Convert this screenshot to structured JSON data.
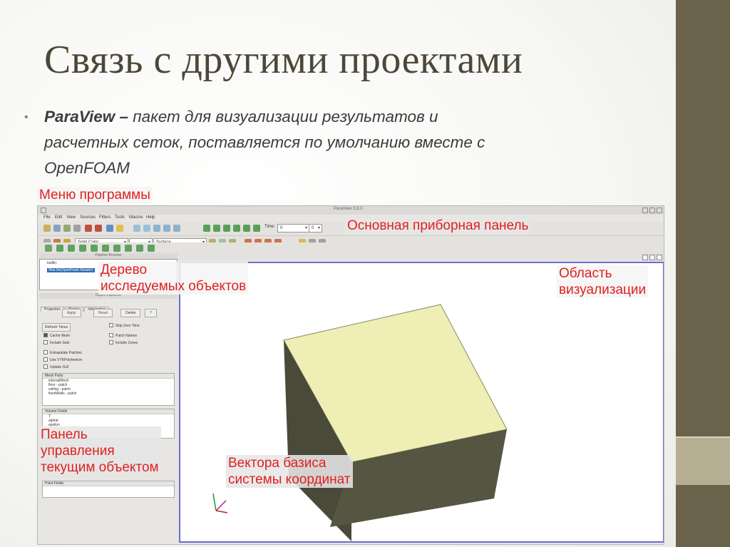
{
  "slide": {
    "title": "Связь с другими проектами",
    "bullet_term": "ParaView – ",
    "bullet_text_1": "пакет для визуализации результатов и",
    "bullet_text_2": "расчетных сеток, поставляется по умолчанию вместе с",
    "bullet_text_3": "OpenFOAM"
  },
  "colors": {
    "accent_stripe": "#6a624a",
    "stripe_light": "#b5ae92",
    "annotation": "#e02020",
    "cube_top": "#efeeb4",
    "cube_side": "#4a4a3a"
  },
  "annotations": {
    "menu": "Меню программы",
    "toolbar": "Основная приборная панель",
    "tree_1": "Дерево",
    "tree_2": "исследуемых объектов",
    "viz_1": "Область",
    "viz_2": "визуализации",
    "panel_1": "Панель",
    "panel_2": "управления",
    "panel_3": "текущим объектом",
    "basis_1": "Вектора базиса",
    "basis_2": "системы координат"
  },
  "app": {
    "window_title": "ParaView 3.8.0",
    "menu": [
      "File",
      "Edit",
      "View",
      "Sources",
      "Filters",
      "Tools",
      "Macros",
      "Help"
    ],
    "time_label": "Time:",
    "time_value": "0",
    "time_step": "0",
    "color_combo": "Solid Color",
    "repr_combo": "Surface",
    "pipeline_header": "Pipeline Browser",
    "pipeline_items": [
      "builtin:",
      "0fsd.0e(OpenFoam Reader)"
    ],
    "inspector_header": "Object Inspector",
    "tabs": [
      "Properties",
      "Display",
      "Information"
    ],
    "buttons": {
      "apply": "Apply",
      "reset": "Reset",
      "delete": "Delete",
      "help": "?"
    },
    "refresh_button": "Refresh Times",
    "props": {
      "skip_zero": "Skip Zero Time",
      "cache_mesh": "Cache Mesh",
      "patch_names": "Patch Names",
      "include_sets": "Include Sets",
      "include_zones": "Include Zones",
      "extrapolate": "Extrapolate Patches",
      "use_vtkpoly": "Use VTKPolyhedron",
      "update_gui": "Update GUI"
    },
    "mesh_parts": {
      "header": "Mesh Parts",
      "items": [
        "internalMesh",
        "floor - patch",
        "ceiling - patch",
        "fixedWalls - patch"
      ]
    },
    "volume_fields": {
      "header": "Volume Fields",
      "items": [
        "T",
        "alphat",
        "epsilon"
      ]
    },
    "point_fields": {
      "header": "Point Fields"
    }
  }
}
